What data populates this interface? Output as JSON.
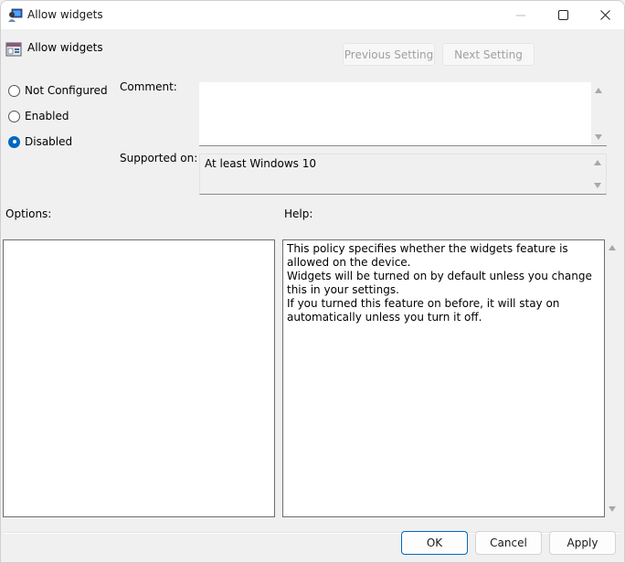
{
  "window": {
    "title": "Allow widgets",
    "icon": "group-policy-computer-icon",
    "controls": {
      "minimize": "minimize-icon",
      "maximize": "maximize-icon",
      "close": "close-icon"
    }
  },
  "header": {
    "policy_icon": "policy-setting-icon",
    "policy_name": "Allow widgets",
    "previous_label": "Previous Setting",
    "next_label": "Next Setting"
  },
  "state": {
    "options": [
      {
        "label": "Not Configured",
        "checked": false
      },
      {
        "label": "Enabled",
        "checked": false
      },
      {
        "label": "Disabled",
        "checked": true
      }
    ],
    "accent_color": "#0067c0"
  },
  "comment": {
    "label": "Comment:",
    "value": ""
  },
  "supported": {
    "label": "Supported on:",
    "value": "At least Windows 10"
  },
  "options_panel": {
    "label": "Options:"
  },
  "help_panel": {
    "label": "Help:",
    "paragraphs": [
      "This policy specifies whether the widgets feature is allowed on the device.",
      "Widgets will be turned on by default unless you change this in your settings.",
      "If you turned this feature on before, it will stay on automatically unless you turn it off."
    ]
  },
  "footer": {
    "ok_label": "OK",
    "cancel_label": "Cancel",
    "apply_label": "Apply"
  }
}
